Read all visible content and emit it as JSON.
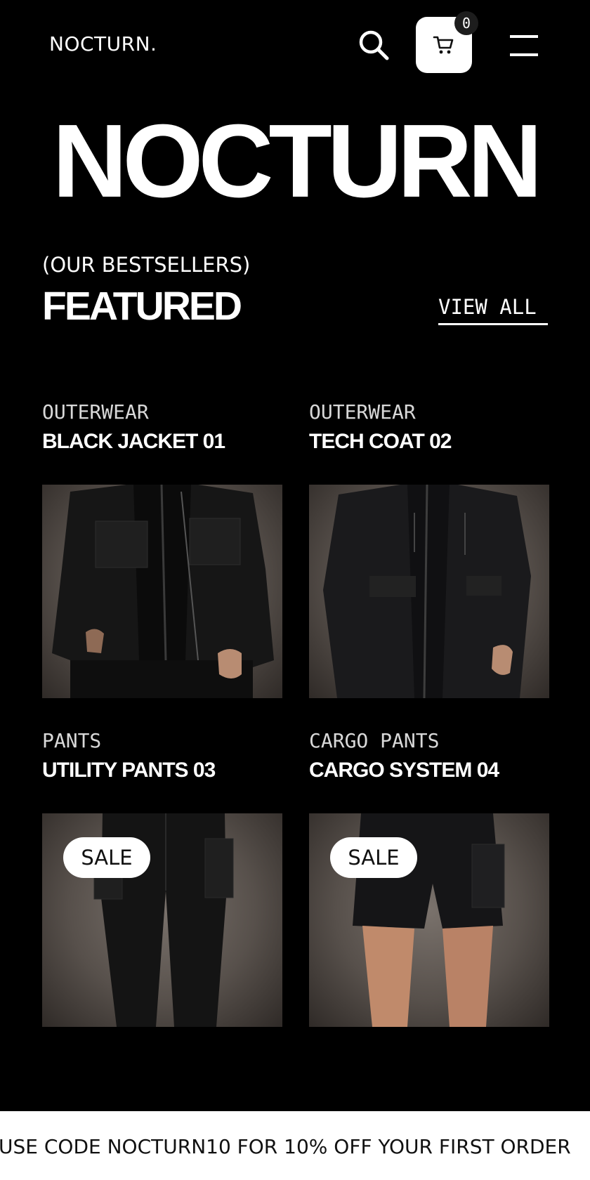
{
  "header": {
    "logo": "NOCTURN.",
    "cart_count": "0"
  },
  "hero": {
    "title": "NOCTURN"
  },
  "featured": {
    "subtitle": "(OUR BESTSELLERS)",
    "title": "FEATURED",
    "view_all": "VIEW ALL"
  },
  "products": [
    {
      "category": "OUTERWEAR",
      "name": "BLACK JACKET 01",
      "badge": ""
    },
    {
      "category": "OUTERWEAR",
      "name": "TECH COAT 02",
      "badge": ""
    },
    {
      "category": "PANTS",
      "name": "UTILITY PANTS 03",
      "badge": "SALE"
    },
    {
      "category": "CARGO PANTS",
      "name": "CARGO SYSTEM 04",
      "badge": "SALE"
    }
  ],
  "promo": {
    "text": "USE CODE NOCTURN10 FOR 10% OFF YOUR FIRST ORDER"
  },
  "colors": {
    "background": "#000000",
    "text": "#ffffff",
    "promo_bar": "#ffffff"
  }
}
